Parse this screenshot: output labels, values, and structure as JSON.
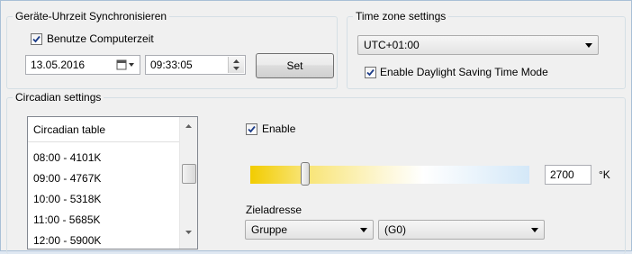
{
  "sync": {
    "legend": "Geräte-Uhrzeit Synchronisieren",
    "use_pc_time_label": "Benutze Computerzeit",
    "use_pc_time_checked": true,
    "date_value": "13.05.2016",
    "time_value": "09:33:05",
    "set_label": "Set"
  },
  "timezone": {
    "legend": "Time zone settings",
    "selected": "UTC+01:00",
    "dst_label": "Enable Daylight Saving Time Mode",
    "dst_checked": true
  },
  "circadian": {
    "legend": "Circadian settings",
    "table_header": "Circadian table",
    "rows": [
      "08:00 - 4101K",
      "09:00 - 4767K",
      "10:00 - 5318K",
      "11:00 - 5685K",
      "12:00 - 5900K"
    ],
    "enable_label": "Enable",
    "enable_checked": true,
    "kelvin_value": "2700",
    "kelvin_unit": "°K",
    "target_label": "Zieladresse",
    "target_type": "Gruppe",
    "target_group": "(G0)"
  },
  "colors": {
    "window_border": "#a9bfd6",
    "slider_warm": "#f2cc00",
    "slider_cool": "#d4e8f8"
  }
}
